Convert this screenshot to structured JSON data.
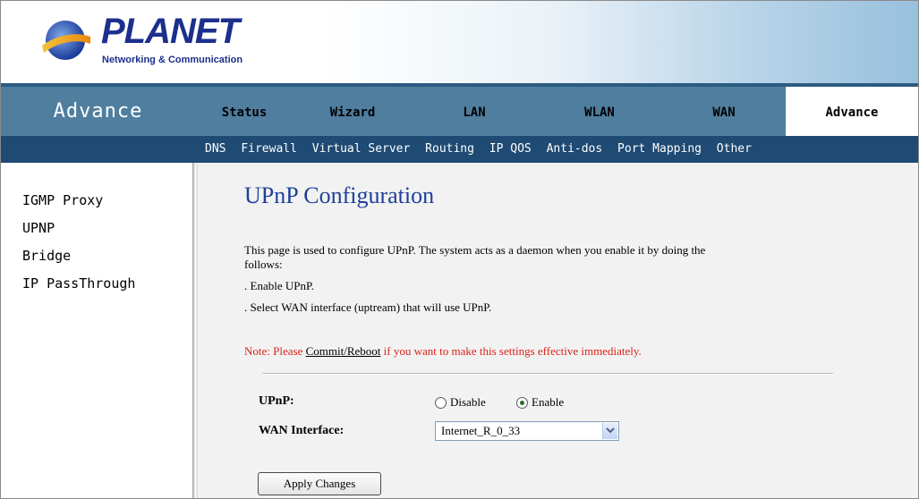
{
  "brand": {
    "name": "PLANET",
    "tagline": "Networking & Communication",
    "colors": {
      "logo": "#1c2f8c",
      "nav": "#4f7e9f",
      "subnav": "#1e4a73",
      "title": "#1e3f9a",
      "note": "#d8231b"
    }
  },
  "nav": {
    "section_title": "Advance",
    "tabs": [
      {
        "label": "Status"
      },
      {
        "label": "Wizard"
      },
      {
        "label": "LAN"
      },
      {
        "label": "WLAN"
      },
      {
        "label": "WAN"
      },
      {
        "label": "Advance",
        "active": true
      }
    ]
  },
  "subnav": {
    "items": [
      "DNS",
      "Firewall",
      "Virtual Server",
      "Routing",
      "IP QOS",
      "Anti-dos",
      "Port Mapping",
      "Other"
    ]
  },
  "sidebar": {
    "items": [
      "IGMP Proxy",
      "UPNP",
      "Bridge",
      "IP PassThrough"
    ]
  },
  "page": {
    "title": "UPnP Configuration",
    "description_line1": "This page is used to configure UPnP. The system acts as a daemon when you enable it by doing the",
    "description_line2": "follows:",
    "step1": ". Enable UPnP.",
    "step2": ". Select WAN interface (uptream) that will use UPnP.",
    "note_prefix": "Note: Please ",
    "note_link": "Commit/Reboot",
    "note_suffix": " if you want to make this settings effective immediately."
  },
  "form": {
    "upnp_label": "UPnP:",
    "upnp_options": [
      {
        "label": "Disable",
        "checked": false
      },
      {
        "label": "Enable",
        "checked": true
      }
    ],
    "wan_label": "WAN Interface:",
    "wan_value": "Internet_R_0_33",
    "apply_label": "Apply Changes"
  },
  "icons": {
    "logo": "planet-globe-icon",
    "dropdown": "chevron-down-icon"
  }
}
